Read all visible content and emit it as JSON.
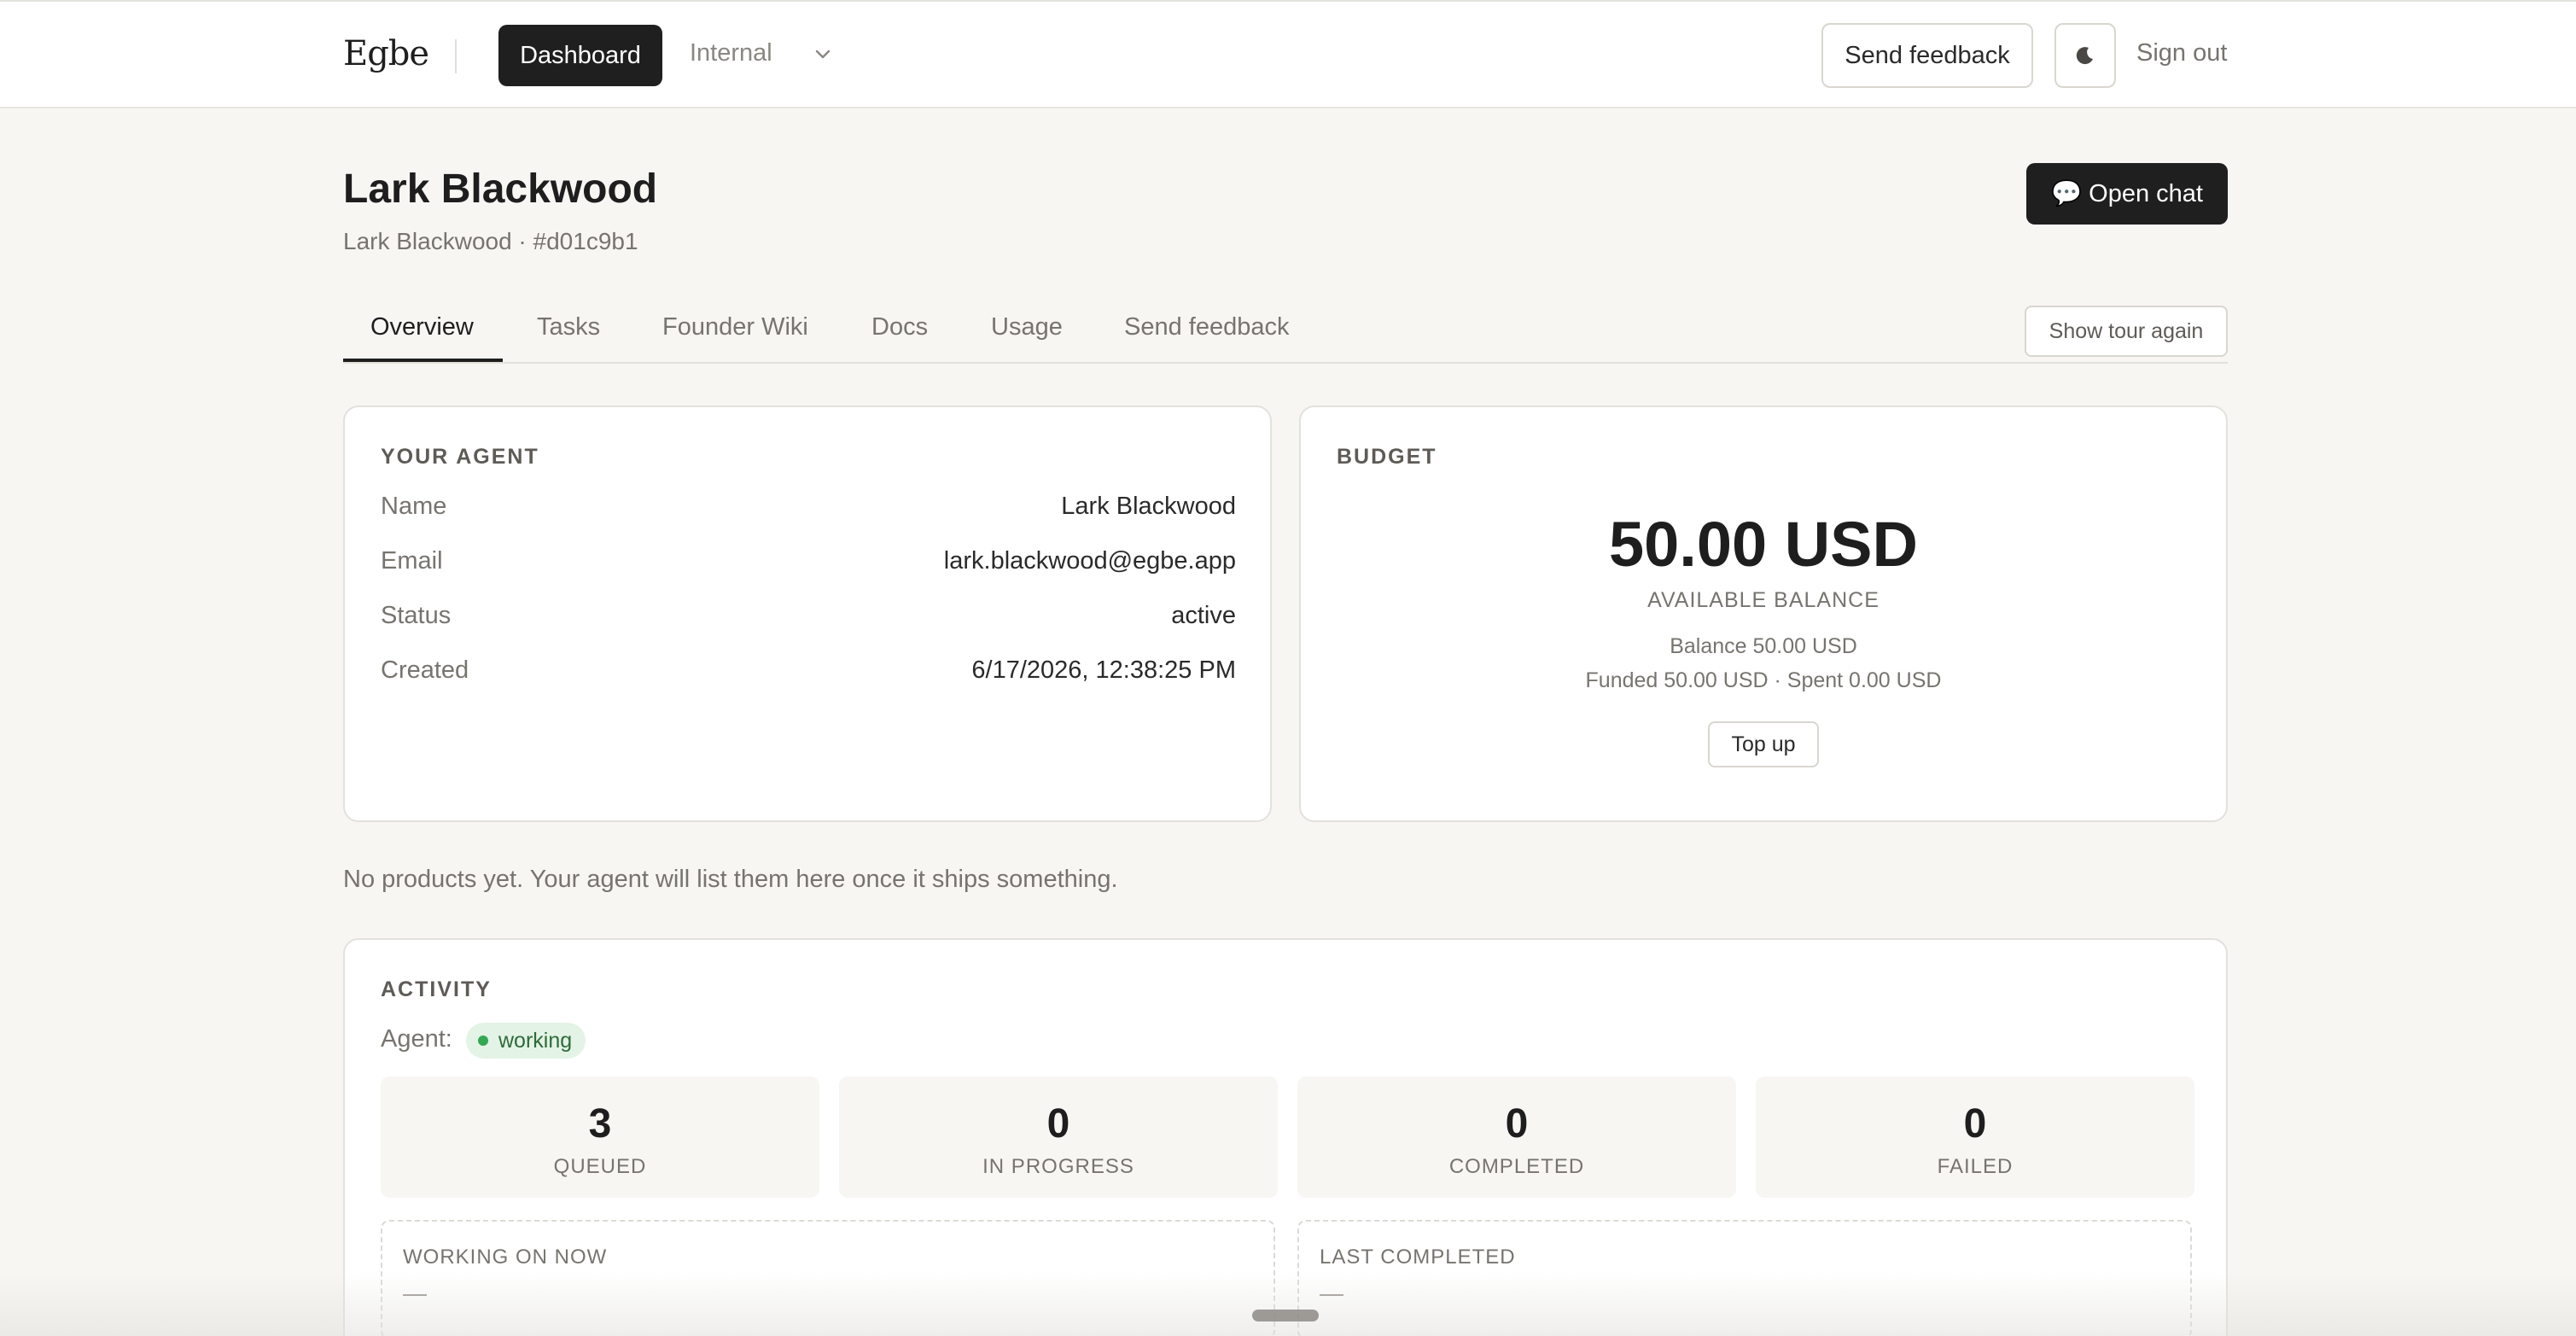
{
  "header": {
    "brand": "Egbe",
    "nav_dashboard": "Dashboard",
    "nav_workspace": "Internal",
    "send_feedback": "Send feedback",
    "sign_out": "Sign out"
  },
  "page": {
    "title": "Lark Blackwood",
    "subtitle": "Lark Blackwood · #d01c9b1",
    "open_chat": "Open chat",
    "open_chat_icon": "💬"
  },
  "tabs": {
    "items": [
      {
        "label": "Overview",
        "active": true
      },
      {
        "label": "Tasks"
      },
      {
        "label": "Founder Wiki"
      },
      {
        "label": "Docs"
      },
      {
        "label": "Usage"
      },
      {
        "label": "Send feedback"
      }
    ],
    "show_tour": "Show tour again"
  },
  "agent_card": {
    "label": "YOUR AGENT",
    "rows": [
      {
        "key": "Name",
        "value": "Lark Blackwood"
      },
      {
        "key": "Email",
        "value": "lark.blackwood@egbe.app"
      },
      {
        "key": "Status",
        "value": "active"
      },
      {
        "key": "Created",
        "value": "6/17/2026, 12:38:25 PM"
      }
    ]
  },
  "budget_card": {
    "label": "BUDGET",
    "amount": "50.00 USD",
    "caption": "AVAILABLE BALANCE",
    "balance_line": "Balance 50.00 USD",
    "funded_line": "Funded 50.00 USD · Spent 0.00 USD",
    "top_up": "Top up"
  },
  "products": {
    "empty_text": "No products yet. Your agent will list them here once it ships something."
  },
  "activity": {
    "label": "ACTIVITY",
    "agent_prefix": "Agent:",
    "agent_status": "working",
    "status_color": "#34a853",
    "stats": [
      {
        "value": "3",
        "label": "QUEUED"
      },
      {
        "value": "0",
        "label": "IN PROGRESS"
      },
      {
        "value": "0",
        "label": "COMPLETED"
      },
      {
        "value": "0",
        "label": "FAILED"
      }
    ],
    "working_on_now": {
      "title": "WORKING ON NOW",
      "value": "—"
    },
    "last_completed": {
      "title": "LAST COMPLETED",
      "value": "—"
    }
  },
  "icons": {
    "theme_toggle": "moon-icon",
    "workspace_dropdown": "chevron-down-icon",
    "chat": "speech-bubble-icon"
  },
  "colors": {
    "primary_button": "#1f1f1f",
    "page_background": "#f7f6f3",
    "working_badge_bg": "#e3f3e6"
  }
}
